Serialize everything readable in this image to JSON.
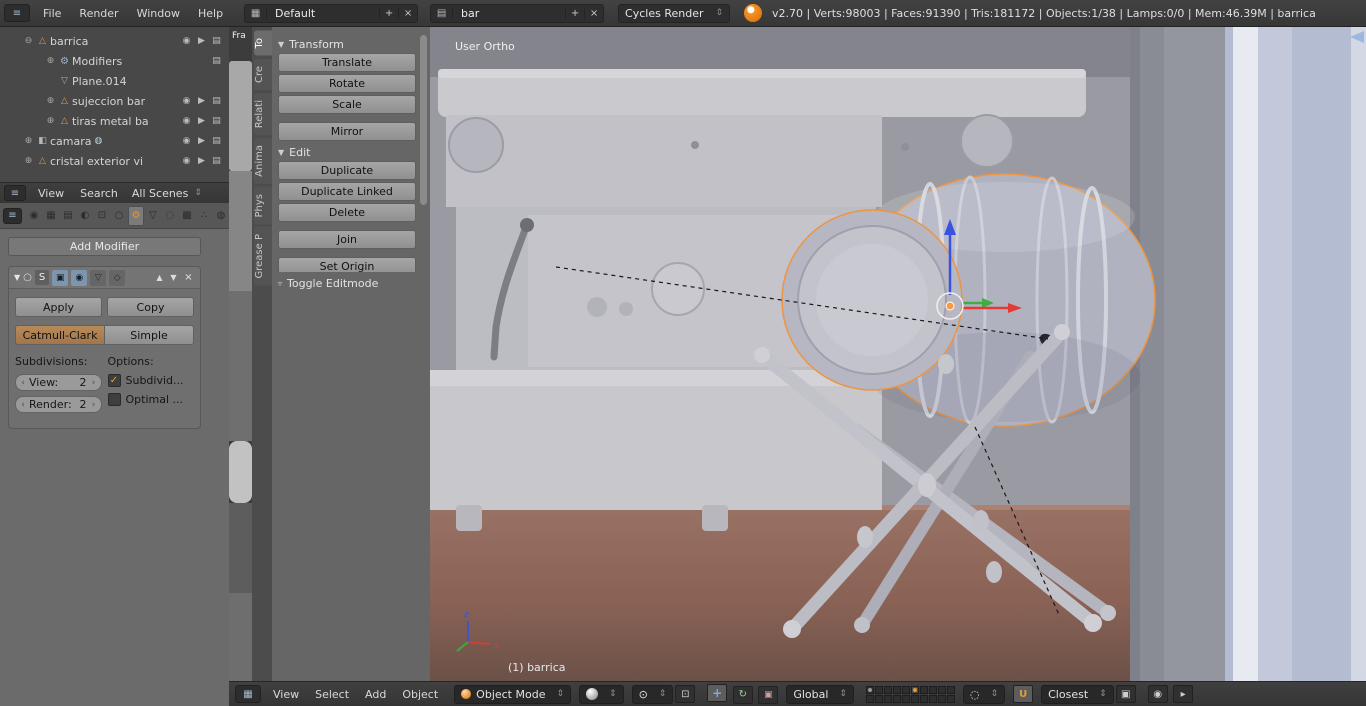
{
  "top_header": {
    "menus": {
      "file": "File",
      "render": "Render",
      "window": "Window",
      "help": "Help"
    },
    "layout_field": "Default",
    "scene_field": "bar",
    "engine_field": "Cycles Render",
    "stats": "v2.70 | Verts:98003 | Faces:91390 | Tris:181172 | Objects:1/38 | Lamps:0/0 | Mem:46.39M | barrica"
  },
  "outliner": {
    "rows": [
      {
        "label": "barrica"
      },
      {
        "label": "Modifiers"
      },
      {
        "label": "Plane.014"
      },
      {
        "label": "sujeccion bar"
      },
      {
        "label": "tiras metal ba"
      },
      {
        "label": "camara"
      },
      {
        "label": "cristal exterior vi"
      }
    ],
    "footer": {
      "view": "View",
      "search": "Search",
      "scenes": "All Scenes"
    }
  },
  "image_strip": {
    "label": "Fra"
  },
  "properties": {
    "add_modifier": "Add Modifier",
    "modifier_name": "S",
    "apply": "Apply",
    "copy": "Copy",
    "catmull": "Catmull-Clark",
    "simple": "Simple",
    "subdivisions": "Subdivisions:",
    "options": "Options:",
    "view_label": "View:",
    "view_value": "2",
    "render_label": "Render:",
    "render_value": "2",
    "subdivide": "Subdivid...",
    "optimal": "Optimal ..."
  },
  "tool_shelf": {
    "tabs": [
      {
        "label": "To"
      },
      {
        "label": "Cre"
      },
      {
        "label": "Relati"
      },
      {
        "label": "Anima"
      },
      {
        "label": "Phys"
      },
      {
        "label": "Grease P"
      }
    ],
    "transform_title": "Transform",
    "translate": "Translate",
    "rotate": "Rotate",
    "scale": "Scale",
    "mirror": "Mirror",
    "edit_title": "Edit",
    "duplicate": "Duplicate",
    "duplicate_linked": "Duplicate Linked",
    "delete": "Delete",
    "join": "Join",
    "set_origin": "Set Origin",
    "toggle_editmode": "Toggle Editmode"
  },
  "viewport": {
    "view_name": "User Ortho",
    "active_object": "(1) barrica",
    "axis_x": "x",
    "axis_z": "z"
  },
  "bottom_header": {
    "menus": {
      "view": "View",
      "select": "Select",
      "add": "Add",
      "object": "Object"
    },
    "mode": "Object Mode",
    "orientation": "Global",
    "snap_target": "Closest"
  },
  "colors": {
    "selection_outline": "#ee9440",
    "axis_x": "#e23b33",
    "axis_y": "#3fae3f",
    "axis_z": "#3a52e0",
    "checkbox_check": "#f0a030",
    "active_toggle_tan": "#a87e50"
  }
}
